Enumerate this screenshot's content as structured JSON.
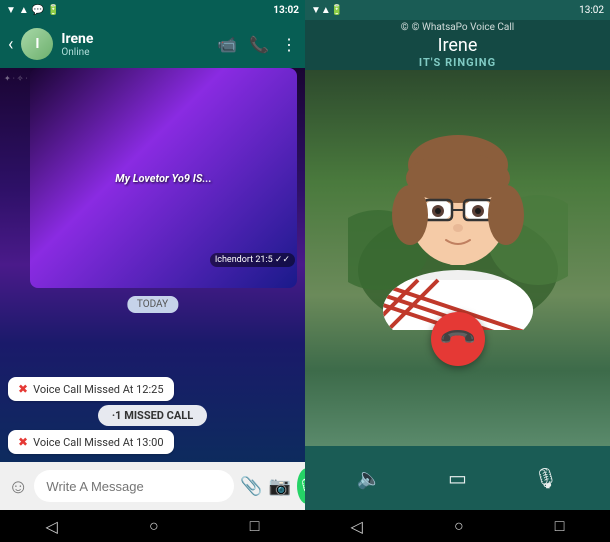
{
  "left": {
    "statusBar": {
      "icons": "📶▼💬🔋",
      "time": "13:02"
    },
    "topBar": {
      "backLabel": "‹",
      "avatarInitial": "I",
      "name": "Irene",
      "status": "Online",
      "videoIcon": "📹",
      "phoneIcon": "📞",
      "moreIcon": "⋮"
    },
    "chat": {
      "mediaBubbleText": "My Lovetor Yo9\nIS...",
      "stampTime": "Ichendort 21:5 ✓✓",
      "todayLabel": "TODAY",
      "messages": [
        {
          "icon": "✖",
          "text": "Voice Call Missed At 12:25"
        },
        {
          "text": "·1 MISSED CALL",
          "center": true
        },
        {
          "icon": "✖",
          "text": "Voice Call Missed At 13:00"
        }
      ]
    },
    "inputArea": {
      "placeholder": "Write A Message",
      "emoji": "☺",
      "attach": "📎",
      "camera": "📷",
      "mic": "🎙"
    },
    "navBar": {
      "back": "◁",
      "home": "○",
      "square": "□"
    }
  },
  "right": {
    "statusBar": {
      "icons": "📶▼🔋",
      "time": "13:02"
    },
    "header": {
      "brandLabel": "© WhatsaPo Voice Call",
      "callerName": "Irene",
      "ringingText": "IT'S RINGING"
    },
    "controls": {
      "speakerIcon": "🔈",
      "videoIcon": "▭",
      "muteIcon": "🎙"
    },
    "endCallIcon": "📞",
    "navBar": {
      "back": "◁",
      "home": "○",
      "square": "□"
    }
  }
}
